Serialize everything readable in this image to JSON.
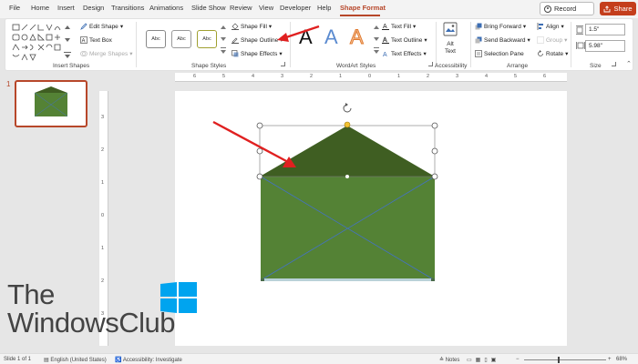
{
  "menu": {
    "tabs": [
      "File",
      "Home",
      "Insert",
      "Design",
      "Transitions",
      "Animations",
      "Slide Show",
      "Review",
      "View",
      "Developer",
      "Help",
      "Shape Format"
    ],
    "active_tab": "Shape Format",
    "record_label": "Record",
    "share_label": "Share"
  },
  "ribbon": {
    "insert_shapes": {
      "edit_shape": "Edit Shape",
      "text_box": "Text Box",
      "merge_shapes": "Merge Shapes",
      "group_label": "Insert Shapes"
    },
    "shape_styles": {
      "presets": [
        "Abc",
        "Abc",
        "Abc"
      ],
      "shape_fill": "Shape Fill",
      "shape_outline": "Shape Outline",
      "shape_effects": "Shape Effects",
      "group_label": "Shape Styles"
    },
    "wordart": {
      "letters": [
        "A",
        "A",
        "A"
      ],
      "text_fill": "Text Fill",
      "text_outline": "Text Outline",
      "text_effects": "Text Effects",
      "group_label": "WordArt Styles"
    },
    "accessibility": {
      "alt_text_line1": "Alt",
      "alt_text_line2": "Text",
      "group_label": "Accessibility"
    },
    "arrange": {
      "bring_forward": "Bring Forward",
      "send_backward": "Send Backward",
      "selection_pane": "Selection Pane",
      "align": "Align",
      "group": "Group",
      "rotate": "Rotate",
      "group_label": "Arrange"
    },
    "size": {
      "height": "1.5\"",
      "width": "5.98\"",
      "group_label": "Size"
    }
  },
  "slides": {
    "current_number": "1"
  },
  "rulers": {
    "horizontal": [
      "6",
      "5",
      "4",
      "3",
      "2",
      "1",
      "0",
      "1",
      "2",
      "3",
      "4",
      "5",
      "6"
    ],
    "vertical": [
      "3",
      "2",
      "1",
      "0",
      "1",
      "2",
      "3"
    ]
  },
  "logo": {
    "line1": "The",
    "line2": "WindowsClub"
  },
  "statusbar": {
    "slide_info": "Slide 1 of 1",
    "language": "English (United States)",
    "accessibility": "Accessibility: Investigate",
    "notes": "Notes",
    "zoom": "68%"
  },
  "colors": {
    "accent": "#b7472a",
    "envelope_flap": "#3f5e22",
    "envelope_body": "#548235",
    "envelope_lines": "#4472c4",
    "arrow": "#e02020"
  }
}
